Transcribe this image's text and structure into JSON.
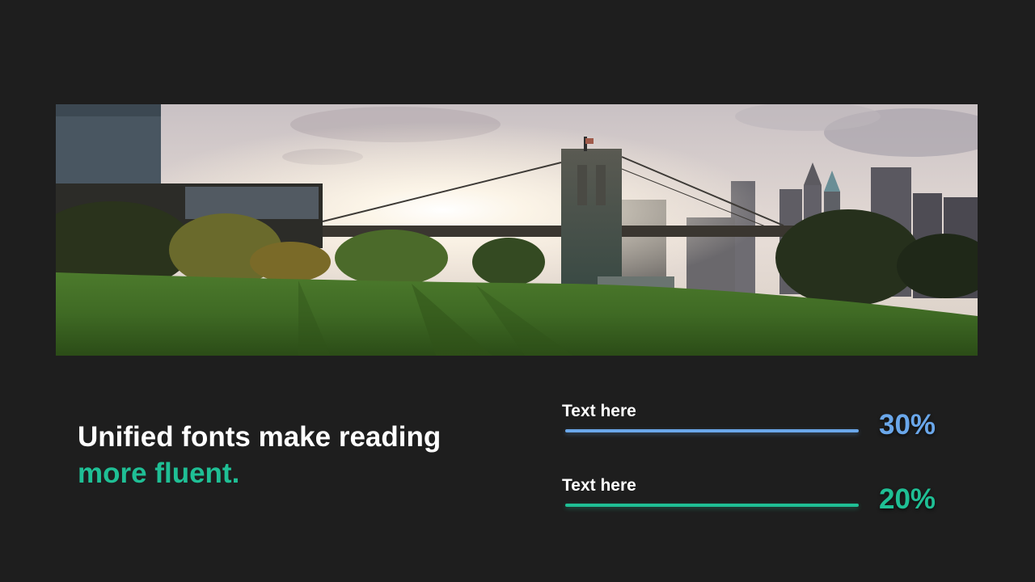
{
  "colors": {
    "background": "#1e1e1e",
    "accent_blue": "#6aa7ea",
    "accent_green": "#1fbf95",
    "text": "#ffffff"
  },
  "photo": {
    "subject": "city-bridge-park-sunset-photo"
  },
  "headline": {
    "line1": "Unified fonts make reading",
    "line2": "more fluent."
  },
  "stats": [
    {
      "label": "Text here",
      "value": "30%",
      "color": "#6aa7ea"
    },
    {
      "label": "Text here",
      "value": "20%",
      "color": "#1fbf95"
    }
  ]
}
